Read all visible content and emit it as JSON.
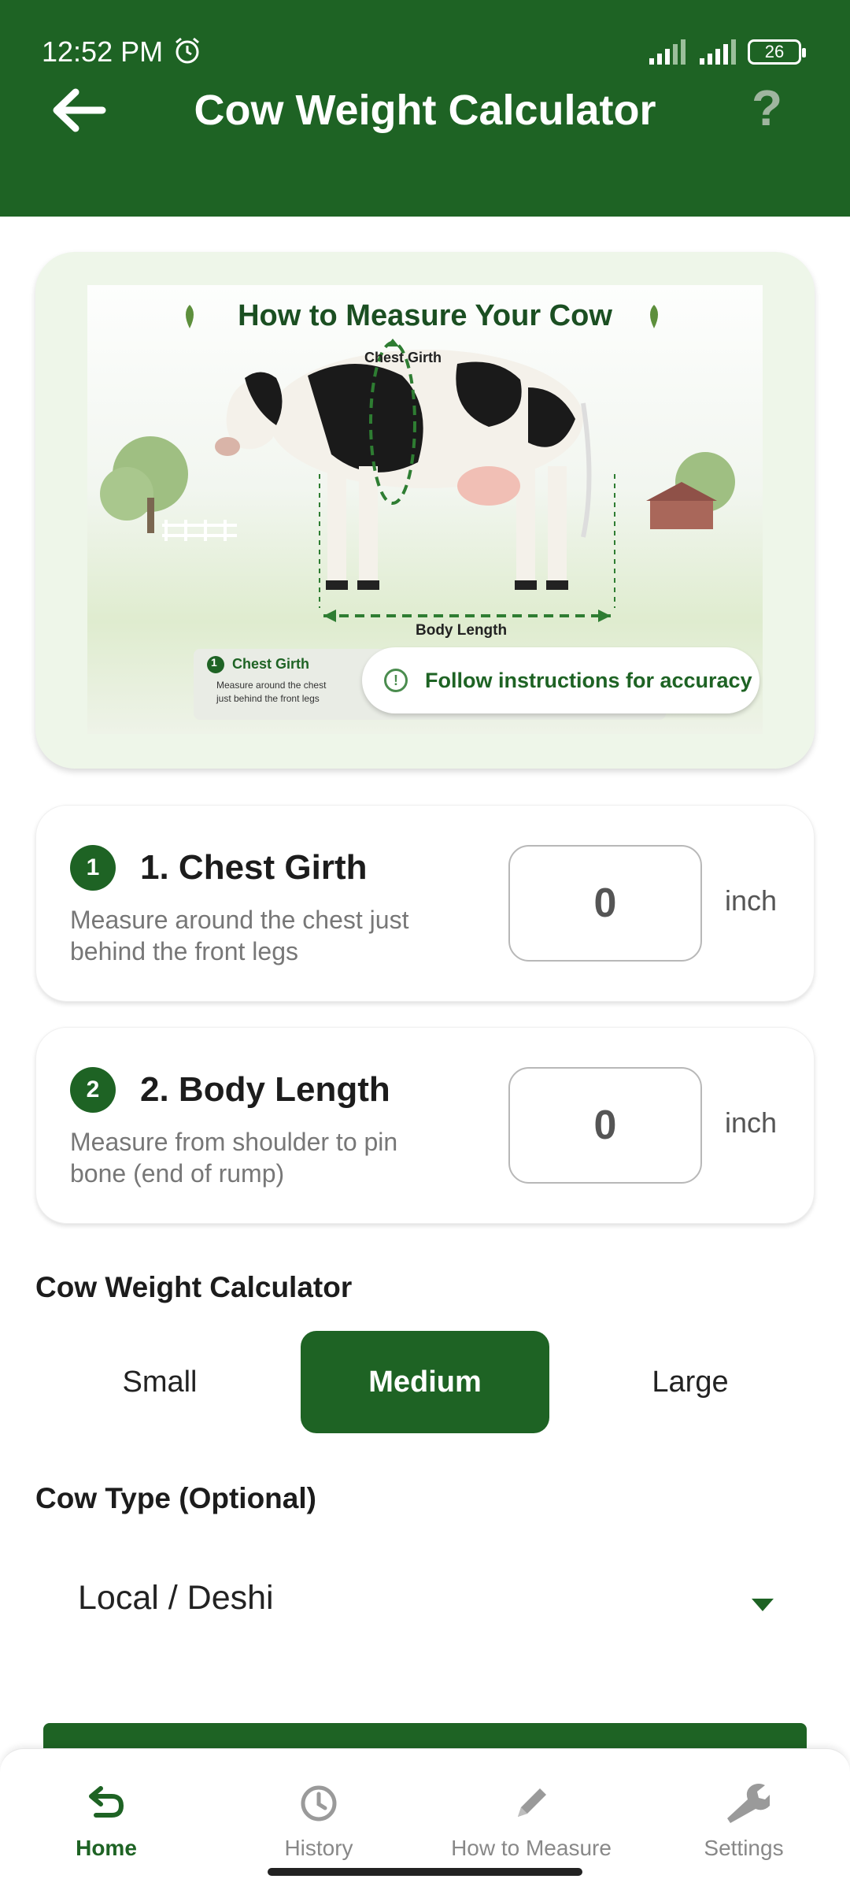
{
  "status_bar": {
    "time": "12:52 PM",
    "battery": "26"
  },
  "header": {
    "title": "Cow Weight Calculator"
  },
  "illustration": {
    "title": "How to Measure Your Cow",
    "chest_girth_label": "Chest Girth",
    "body_length_label": "Body Length",
    "legend_title": "Chest Girth",
    "legend_number": "1",
    "legend_text_line1": "Measure around the chest",
    "legend_text_line2": "just behind the front legs"
  },
  "accuracy_note": "Follow instructions for accuracy",
  "measurements": [
    {
      "number": "1",
      "title": "1. Chest Girth",
      "description": "Measure around the chest just behind the front legs",
      "value": "0",
      "unit": "inch"
    },
    {
      "number": "2",
      "title": "2. Body Length",
      "description": "Measure from shoulder to pin bone (end of rump)",
      "value": "0",
      "unit": "inch"
    }
  ],
  "size_section": {
    "label": "Cow Weight Calculator",
    "options": [
      "Small",
      "Medium",
      "Large"
    ],
    "selected": "Medium"
  },
  "cow_type": {
    "label": "Cow Type (Optional)",
    "value": "Local / Deshi"
  },
  "nav": [
    {
      "label": "Home",
      "icon": "home-back-arrow-icon",
      "active": true
    },
    {
      "label": "History",
      "icon": "clock-icon",
      "active": false
    },
    {
      "label": "How to Measure",
      "icon": "pencil-icon",
      "active": false
    },
    {
      "label": "Settings",
      "icon": "wrench-icon",
      "active": false
    }
  ],
  "colors": {
    "primary": "#1e6324",
    "card_tint": "#eef6e9"
  }
}
